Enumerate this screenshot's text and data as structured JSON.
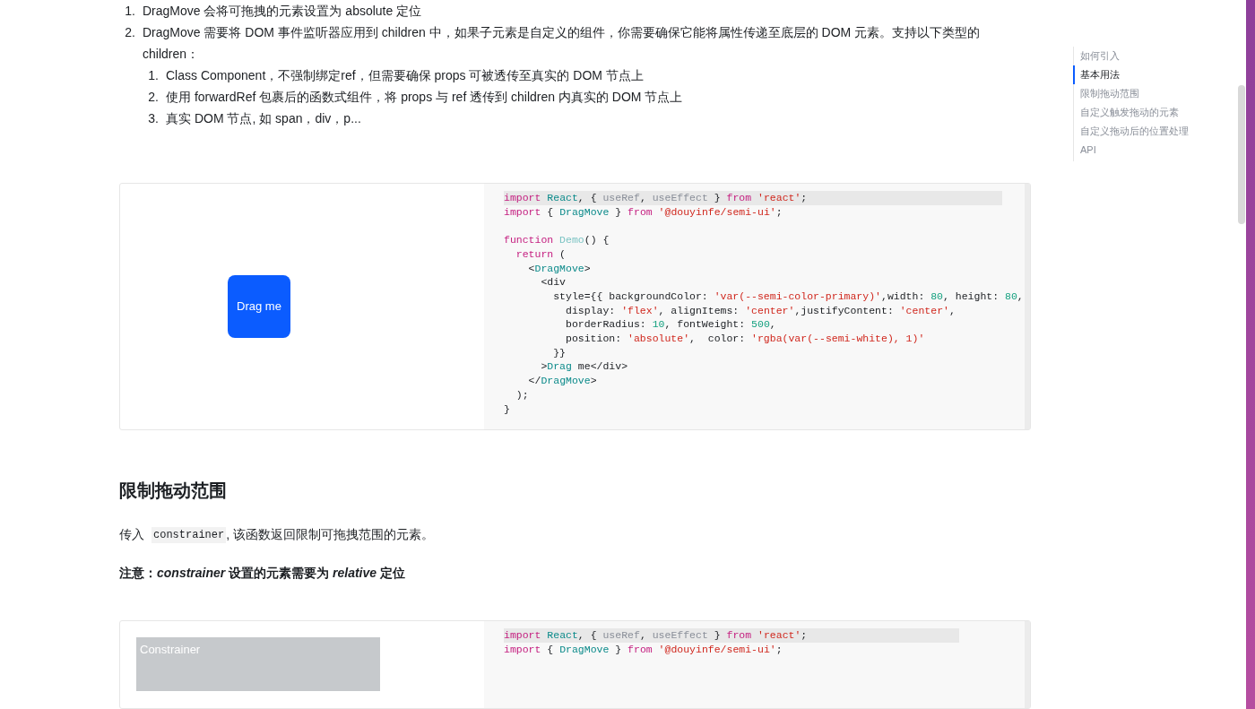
{
  "intro_list": [
    {
      "number": "1.",
      "text": "DragMove 会将可拖拽的元素设置为 absolute 定位"
    },
    {
      "number": "2.",
      "text": "DragMove 需要将 DOM 事件监听器应用到 children 中，如果子元素是自定义的组件，你需要确保它能将属性传递至底层的 DOM 元素。支持以下类型的 children：",
      "children": [
        {
          "number": "1.",
          "text": "Class Component，不强制绑定ref，但需要确保 props 可被透传至真实的 DOM 节点上"
        },
        {
          "number": "2.",
          "text": "使用 forwardRef 包裹后的函数式组件，将 props 与 ref 透传到 children 内真实的 DOM 节点上"
        },
        {
          "number": "3.",
          "text": "真实 DOM 节点, 如 span，div，p..."
        }
      ]
    }
  ],
  "demo1": {
    "button": "Drag me",
    "code": [
      {
        "tokens": [
          {
            "kind": "kw",
            "t": "import"
          },
          {
            "kind": "comp",
            "t": " React"
          },
          {
            "kind": "p",
            "t": ", { "
          },
          {
            "kind": "muted",
            "t": "useRef"
          },
          {
            "kind": "p",
            "t": ", "
          },
          {
            "kind": "muted",
            "t": "useEffect"
          },
          {
            "kind": "p",
            "t": " } "
          },
          {
            "kind": "kw",
            "t": "from"
          },
          {
            "kind": "str",
            "t": " 'react'"
          },
          {
            "kind": "p",
            "t": ";"
          }
        ]
      },
      {
        "tokens": [
          {
            "kind": "kw",
            "t": "import"
          },
          {
            "kind": "p",
            "t": " { "
          },
          {
            "kind": "comp",
            "t": "DragMove"
          },
          {
            "kind": "p",
            "t": " } "
          },
          {
            "kind": "kw",
            "t": "from"
          },
          {
            "kind": "str",
            "t": " '@douyinfe/semi-ui'"
          },
          {
            "kind": "p",
            "t": ";"
          }
        ]
      },
      {
        "gap_before": true,
        "tokens": [
          {
            "kind": "kw",
            "t": "function"
          },
          {
            "kind": "fn",
            "t": " Demo"
          },
          {
            "kind": "p",
            "t": "() {"
          }
        ]
      },
      {
        "tokens": [
          {
            "kind": "kw",
            "t": "  return"
          },
          {
            "kind": "p",
            "t": " ("
          }
        ]
      },
      {
        "tokens": [
          {
            "kind": "p",
            "t": "    <"
          },
          {
            "kind": "comp",
            "t": "DragMove"
          },
          {
            "kind": "p",
            "t": ">"
          }
        ]
      },
      {
        "tokens": [
          {
            "kind": "p",
            "t": "      <div"
          }
        ]
      },
      {
        "tokens": [
          {
            "kind": "p",
            "t": "        style={{ backgroundColor: "
          },
          {
            "kind": "str",
            "t": "'var(--semi-color-primary)'"
          },
          {
            "kind": "p",
            "t": ",width: "
          },
          {
            "kind": "num",
            "t": "80"
          },
          {
            "kind": "p",
            "t": ", height: "
          },
          {
            "kind": "num",
            "t": "80"
          },
          {
            "kind": "p",
            "t": ","
          }
        ]
      },
      {
        "tokens": [
          {
            "kind": "p",
            "t": "          display: "
          },
          {
            "kind": "str",
            "t": "'flex'"
          },
          {
            "kind": "p",
            "t": ", alignItems: "
          },
          {
            "kind": "str",
            "t": "'center'"
          },
          {
            "kind": "p",
            "t": ",justifyContent: "
          },
          {
            "kind": "str",
            "t": "'center'"
          },
          {
            "kind": "p",
            "t": ","
          }
        ]
      },
      {
        "tokens": [
          {
            "kind": "p",
            "t": "          borderRadius: "
          },
          {
            "kind": "num",
            "t": "10"
          },
          {
            "kind": "p",
            "t": ", fontWeight: "
          },
          {
            "kind": "num",
            "t": "500"
          },
          {
            "kind": "p",
            "t": ","
          }
        ]
      },
      {
        "tokens": [
          {
            "kind": "p",
            "t": "          position: "
          },
          {
            "kind": "str",
            "t": "'absolute'"
          },
          {
            "kind": "p",
            "t": ",  color: "
          },
          {
            "kind": "str",
            "t": "'rgba(var(--semi-white), 1)'"
          }
        ]
      },
      {
        "tokens": [
          {
            "kind": "p",
            "t": "        }}"
          }
        ]
      },
      {
        "tokens": [
          {
            "kind": "p",
            "t": "      >"
          },
          {
            "kind": "comp",
            "t": "Drag"
          },
          {
            "kind": "p",
            "t": " me</div>"
          }
        ]
      },
      {
        "tokens": [
          {
            "kind": "p",
            "t": "    </"
          },
          {
            "kind": "comp",
            "t": "DragMove"
          },
          {
            "kind": "p",
            "t": ">"
          }
        ]
      },
      {
        "tokens": [
          {
            "kind": "p",
            "t": "  );"
          }
        ]
      },
      {
        "tokens": [
          {
            "kind": "p",
            "t": "}"
          }
        ]
      }
    ]
  },
  "section": {
    "heading": "限制拖动范围",
    "para_before": "传入",
    "para_code": "constrainer",
    "para_after": ", 该函数返回限制可拖拽范围的元素。",
    "note": "注意：*constrainer* 设置的元素需要为 *relative* 定位"
  },
  "demo2": {
    "constrainer_label": "Constrainer",
    "code": [
      {
        "tokens": [
          {
            "kind": "kw",
            "t": "import"
          },
          {
            "kind": "comp",
            "t": " React"
          },
          {
            "kind": "p",
            "t": ", { "
          },
          {
            "kind": "muted",
            "t": "useRef"
          },
          {
            "kind": "p",
            "t": ", "
          },
          {
            "kind": "muted",
            "t": "useEffect"
          },
          {
            "kind": "p",
            "t": " } "
          },
          {
            "kind": "kw",
            "t": "from"
          },
          {
            "kind": "str",
            "t": " 'react'"
          },
          {
            "kind": "p",
            "t": ";"
          }
        ]
      },
      {
        "tokens": [
          {
            "kind": "kw",
            "t": "import"
          },
          {
            "kind": "p",
            "t": " { "
          },
          {
            "kind": "comp",
            "t": "DragMove"
          },
          {
            "kind": "p",
            "t": " } "
          },
          {
            "kind": "kw",
            "t": "from"
          },
          {
            "kind": "str",
            "t": " '@douyinfe/semi-ui'"
          },
          {
            "kind": "p",
            "t": ";"
          }
        ]
      }
    ]
  },
  "toc": [
    {
      "label": "如何引入",
      "selected": false
    },
    {
      "label": "基本用法",
      "selected": true
    },
    {
      "label": "限制拖动范围",
      "selected": false
    },
    {
      "label": "自定义触发拖动的元素",
      "selected": false
    },
    {
      "label": "自定义拖动后的位置处理",
      "selected": false
    },
    {
      "label": "API",
      "selected": false
    }
  ]
}
